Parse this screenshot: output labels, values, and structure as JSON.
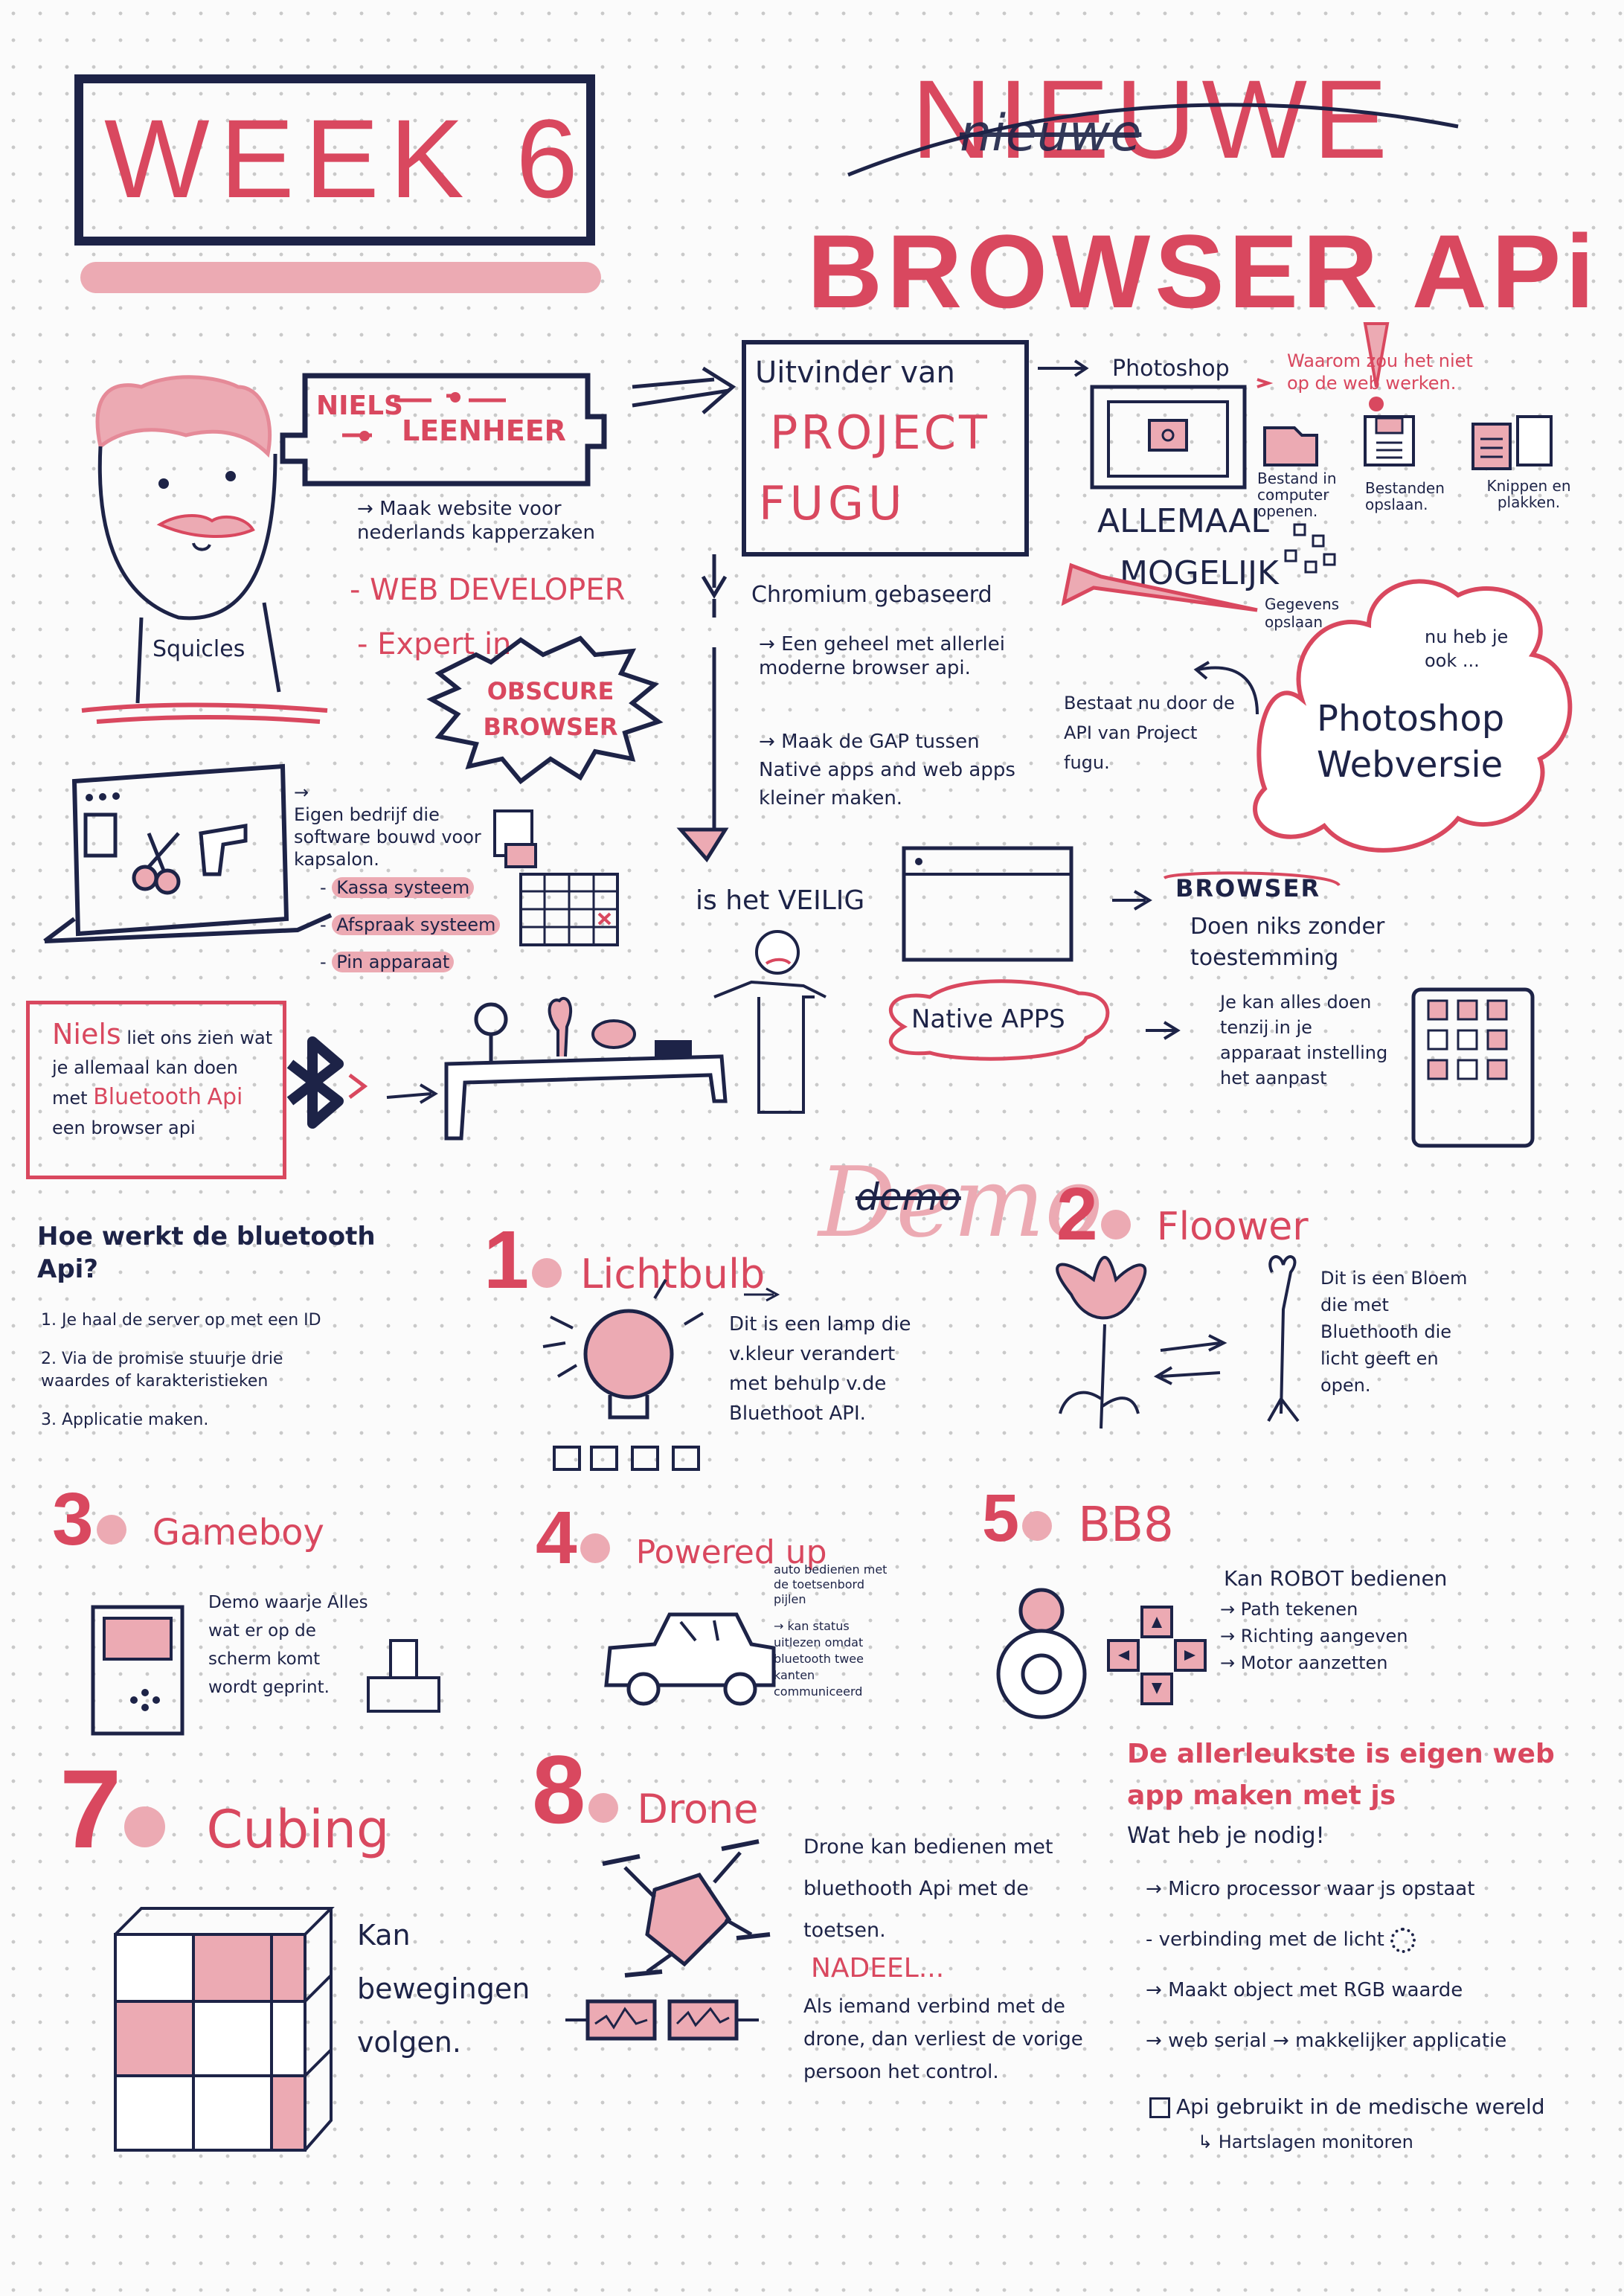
{
  "header": {
    "week": "WEEK 6",
    "title_struck": "nieuwe",
    "title_new": "NIEUWE",
    "title_main": "BROWSER APi"
  },
  "profile": {
    "name_first": "NIELS",
    "name_last": "LEENHEER",
    "shirt_label": "Squicles",
    "bullet_site": "Maak website voor nederlands kapperzaken",
    "role_web": "- WEB DEVELOPER",
    "role_expert": "- Expert in",
    "obscure": "OBSCURE BROWSER"
  },
  "company": {
    "lead": "Eigen bedrijf die software bouwd voor kapsalon.",
    "items": [
      "Kassa systeem",
      "Afspraak systeem",
      "Pin apparaat"
    ]
  },
  "fugu": {
    "inventor_label": "Uitvinder van",
    "project": "PROJECT",
    "fugu": "FUGU",
    "chromium": "Chromium gebaseerd",
    "bullet1": "Een geheel met allerlei moderne browser api.",
    "bullet2": "Maak de GAP tussen Native apps and web apps kleiner maken.",
    "safe": "is het VEILIG"
  },
  "photoshop": {
    "label": "Photoshop",
    "why_not": "Waarom zou het niet op de web werken.",
    "icons": [
      {
        "icon": "folder-icon",
        "label": "Bestand in computer openen."
      },
      {
        "icon": "floppy-icon",
        "label": "Bestanden opslaan."
      },
      {
        "icon": "clipboard-icon",
        "label": "Knippen en plakken."
      }
    ],
    "data_save": "Gegevens opslaan",
    "allemaal": "ALLEMAAL",
    "mogelijk": "MOGELIJK",
    "exists": "Bestaat nu door de API van Project fugu.",
    "cloud_small": "nu heb je ook ...",
    "cloud_big": "Photoshop Webversie"
  },
  "browser_vs_native": {
    "browser_label": "BROWSER",
    "browser_text": "Doen niks zonder toestemming",
    "native_label": "Native APPS",
    "native_text": "Je kan alles doen tenzij in je apparaat instelling het aanpast"
  },
  "bluetooth_intro": {
    "name": "Niels",
    "text_a": "liet ons zien wat je allemaal kan doen met",
    "bt": "Bluetooth",
    "api": "Api",
    "text_b": "een browser api"
  },
  "how": {
    "title": "Hoe werkt de bluetooth Api?",
    "steps": [
      "1. Je haal de server op met een ID",
      "2. Via de promise stuurje drie waardes of karakteristieken",
      "3. Applicatie maken."
    ]
  },
  "demo": {
    "title": "Demo",
    "struck": "demo"
  },
  "demos": [
    {
      "num": "1",
      "title": "Lichtbulb",
      "desc": "Dit is een lamp die v.kleur verandert met behulp v.de Bluethoot API."
    },
    {
      "num": "2",
      "title": "Floower",
      "desc": "Dit is een Bloem die met Bluethooth die licht geeft en open."
    },
    {
      "num": "3",
      "title": "Gameboy",
      "desc": "Demo waarje Alles wat er op de scherm komt wordt geprint."
    },
    {
      "num": "4",
      "title": "Powered up",
      "desc_a": "auto bedienen met de toetsenbord pijlen",
      "desc_b": "kan status uitlezen omdat bluetooth twee kanten communiceerd"
    },
    {
      "num": "5",
      "title": "BB8",
      "lead": "Kan ROBOT bedienen",
      "items": [
        "Path tekenen",
        "Richting aangeven",
        "Motor aanzetten"
      ]
    },
    {
      "num": "7",
      "title": "Cubing",
      "desc": "Kan bewegingen volgen."
    },
    {
      "num": "8",
      "title": "Drone",
      "desc": "Drone kan bedienen met bluethooth Api met de toetsen.",
      "nadeel": "NADEEL...",
      "nadeel_text": "Als iemand verbind met de drone, dan verliest de vorige persoon het control."
    }
  ],
  "final": {
    "title": "De allerleukste is eigen web app maken met js",
    "need": "Wat heb je nodig!",
    "items": [
      "Micro processor waar js opstaat",
      "verbinding met de licht",
      "Maakt object met RGB waarde",
      "web serial → makkelijker applicatie"
    ],
    "medical": "Api gebruikt in de medische wereld",
    "medical_sub": "Hartslagen monitoren"
  },
  "colors": {
    "navy": "#1d2347",
    "red": "#d9485f",
    "pink": "#ecaab3"
  }
}
